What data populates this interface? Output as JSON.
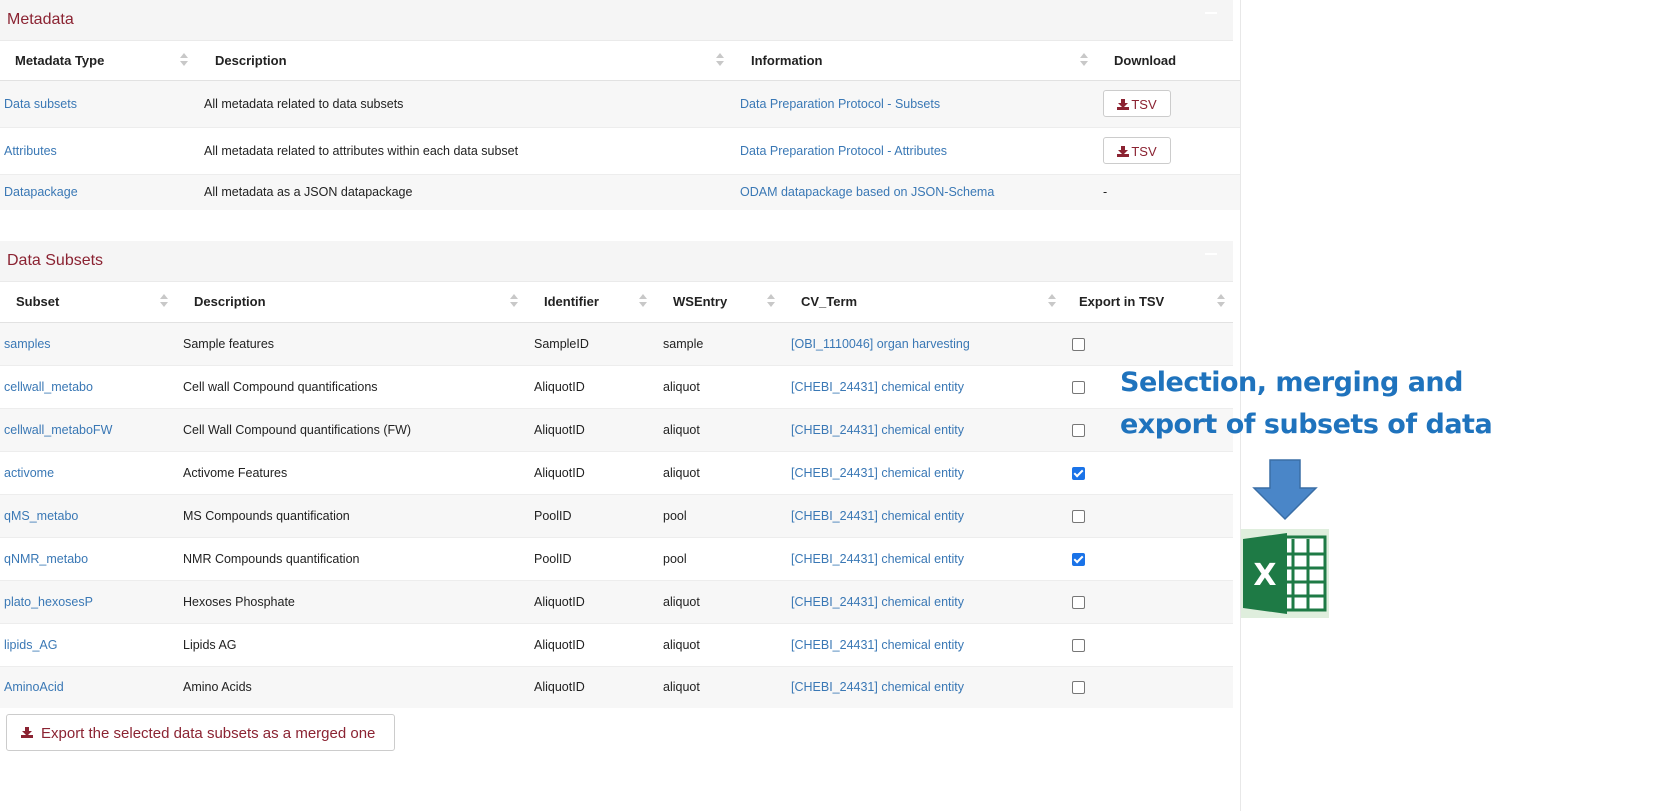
{
  "metadata_panel": {
    "title": "Metadata",
    "columns": [
      "Metadata Type",
      "Description",
      "Information",
      "Download"
    ],
    "rows": [
      {
        "type": "Data subsets",
        "description": "All metadata related to data subsets",
        "information": "Data Preparation Protocol - Subsets",
        "download": "TSV"
      },
      {
        "type": "Attributes",
        "description": "All metadata related to attributes within each data subset",
        "information": "Data Preparation Protocol - Attributes",
        "download": "TSV"
      },
      {
        "type": "Datapackage",
        "description": "All metadata as a JSON datapackage",
        "information": "ODAM datapackage based on JSON-Schema",
        "download": "-"
      }
    ]
  },
  "subsets_panel": {
    "title": "Data Subsets",
    "columns": [
      "Subset",
      "Description",
      "Identifier",
      "WSEntry",
      "CV_Term",
      "Export in TSV"
    ],
    "rows": [
      {
        "subset": "samples",
        "description": "Sample features",
        "identifier": "SampleID",
        "wsentry": "sample",
        "cv_term": "[OBI_1110046] organ harvesting",
        "checked": false
      },
      {
        "subset": "cellwall_metabo",
        "description": "Cell wall Compound quantifications",
        "identifier": "AliquotID",
        "wsentry": "aliquot",
        "cv_term": "[CHEBI_24431] chemical entity",
        "checked": false
      },
      {
        "subset": "cellwall_metaboFW",
        "description": "Cell Wall Compound quantifications (FW)",
        "identifier": "AliquotID",
        "wsentry": "aliquot",
        "cv_term": "[CHEBI_24431] chemical entity",
        "checked": false
      },
      {
        "subset": "activome",
        "description": "Activome Features",
        "identifier": "AliquotID",
        "wsentry": "aliquot",
        "cv_term": "[CHEBI_24431] chemical entity",
        "checked": true
      },
      {
        "subset": "qMS_metabo",
        "description": "MS Compounds quantification",
        "identifier": "PoolID",
        "wsentry": "pool",
        "cv_term": "[CHEBI_24431] chemical entity",
        "checked": false
      },
      {
        "subset": "qNMR_metabo",
        "description": "NMR Compounds quantification",
        "identifier": "PoolID",
        "wsentry": "pool",
        "cv_term": "[CHEBI_24431] chemical entity",
        "checked": true
      },
      {
        "subset": "plato_hexosesP",
        "description": "Hexoses Phosphate",
        "identifier": "AliquotID",
        "wsentry": "aliquot",
        "cv_term": "[CHEBI_24431] chemical entity",
        "checked": false
      },
      {
        "subset": "lipids_AG",
        "description": "Lipids AG",
        "identifier": "AliquotID",
        "wsentry": "aliquot",
        "cv_term": "[CHEBI_24431] chemical entity",
        "checked": false
      },
      {
        "subset": "AminoAcid",
        "description": "Amino Acids",
        "identifier": "AliquotID",
        "wsentry": "aliquot",
        "cv_term": "[CHEBI_24431] chemical entity",
        "checked": false
      }
    ],
    "merge_button": "Export the selected data subsets as a merged one"
  },
  "annotation": {
    "text": "Selection, merging and\nexport of subsets of data",
    "excel_letter": "X"
  },
  "colors": {
    "panel_title": "#8b2332",
    "link": "#3a78b5",
    "annotation": "#1f73bd",
    "arrow": "#4a86c8",
    "excel_green": "#1e7a45",
    "checkbox_on": "#1a73e8"
  },
  "icons": [
    "download-icon",
    "down-arrow-icon",
    "excel-icon",
    "sort-icon"
  ]
}
